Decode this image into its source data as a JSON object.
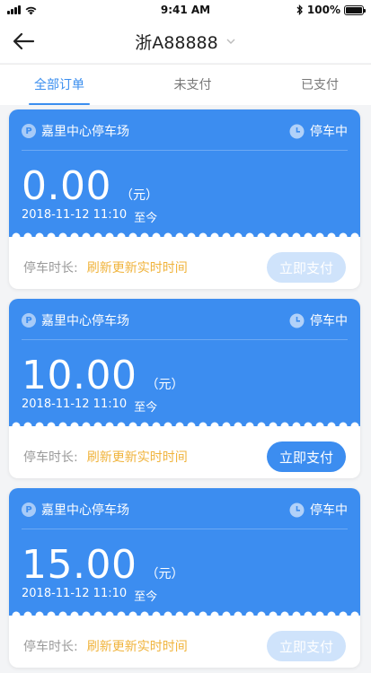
{
  "status_bar": {
    "time": "9:41 AM",
    "battery": "100%",
    "battery_level": 1.0
  },
  "nav": {
    "title": "浙A88888",
    "back_icon": "back-arrow-icon",
    "dropdown_icon": "chevron-down-icon"
  },
  "tabs": [
    {
      "label": "全部订单",
      "active": true
    },
    {
      "label": "未支付",
      "active": false
    },
    {
      "label": "已支付",
      "active": false
    }
  ],
  "colors": {
    "accent": "#3c8df0",
    "tab_active": "#3a8eef",
    "link": "#f0b33b",
    "disabled_button": "#cfe3fb"
  },
  "orders": [
    {
      "lot_name": "嘉里中心停车场",
      "status": "停车中",
      "amount": "0.00",
      "unit": "（元）",
      "start_time": "2018-11-12 11:10",
      "until": "至今",
      "duration_label": "停车时长:",
      "duration_link": "刷新更新实时时间",
      "pay_label": "立即支付",
      "pay_enabled": false
    },
    {
      "lot_name": "嘉里中心停车场",
      "status": "停车中",
      "amount": "10.00",
      "unit": "（元）",
      "start_time": "2018-11-12 11:10",
      "until": "至今",
      "duration_label": "停车时长:",
      "duration_link": "刷新更新实时时间",
      "pay_label": "立即支付",
      "pay_enabled": true
    },
    {
      "lot_name": "嘉里中心停车场",
      "status": "停车中",
      "amount": "15.00",
      "unit": "（元）",
      "start_time": "2018-11-12 11:10",
      "until": "至今",
      "duration_label": "停车时长:",
      "duration_link": "刷新更新实时时间",
      "pay_label": "立即支付",
      "pay_enabled": false
    }
  ]
}
